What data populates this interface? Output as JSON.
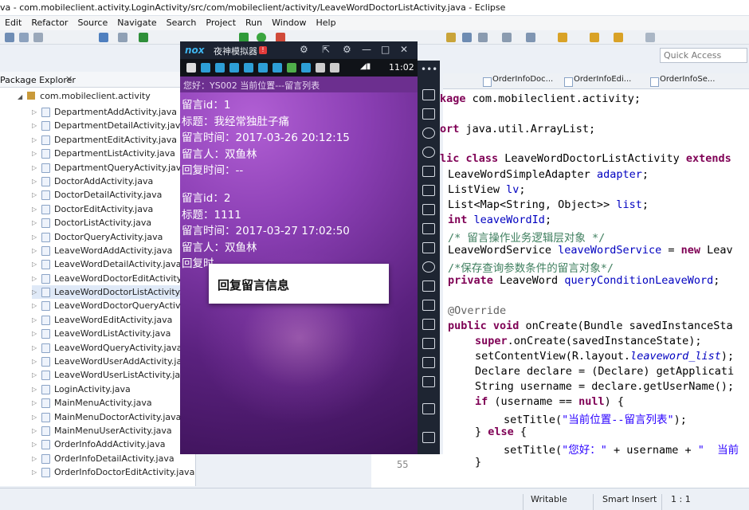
{
  "window": {
    "title": "va - com.mobileclient.activity.LoginActivity/src/com/mobileclient/activity/LeaveWordDoctorListActivity.java - Eclipse"
  },
  "menu": [
    "Edit",
    "Refactor",
    "Source",
    "Navigate",
    "Search",
    "Project",
    "Run",
    "Window",
    "Help"
  ],
  "quick_access": {
    "placeholder": "Quick Access"
  },
  "package_explorer": {
    "tab_label": "Package Explorer",
    "tab_close": "✕",
    "root": "com.mobileclient.activity",
    "files": [
      "DepartmentAddActivity.java",
      "DepartmentDetailActivity.java",
      "DepartmentEditActivity.java",
      "DepartmentListActivity.java",
      "DepartmentQueryActivity.java",
      "DoctorAddActivity.java",
      "DoctorDetailActivity.java",
      "DoctorEditActivity.java",
      "DoctorListActivity.java",
      "DoctorQueryActivity.java",
      "LeaveWordAddActivity.java",
      "LeaveWordDetailActivity.java",
      "LeaveWordDoctorEditActivity.java",
      "LeaveWordDoctorListActivity.java",
      "LeaveWordDoctorQueryActivity",
      "LeaveWordEditActivity.java",
      "LeaveWordListActivity.java",
      "LeaveWordQueryActivity.java",
      "LeaveWordUserAddActivity.java",
      "LeaveWordUserListActivity.java",
      "LoginActivity.java",
      "MainMenuActivity.java",
      "MainMenuDoctorActivity.java",
      "MainMenuUserActivity.java",
      "OrderInfoAddActivity.java",
      "OrderInfoDetailActivity.java",
      "OrderInfoDoctorEditActivity.java"
    ],
    "selected_index": 13
  },
  "editor": {
    "tabs": [
      "OrderInfoDoc...",
      "OrderInfoEdi...",
      "OrderInfoSe..."
    ],
    "gutter_line": "55",
    "code": {
      "l1a": "kage",
      "l1b": " com.mobileclient.activity;",
      "l2a": "ort",
      "l2b": " java.util.ArrayList;",
      "l3a": "lic class",
      "l3b": " LeaveWordDoctorListActivity ",
      "l3c": "extends",
      "l4a": "LeaveWordSimpleAdapter ",
      "l4b": "adapter",
      "l4c": ";",
      "l5a": "ListView ",
      "l5b": "lv",
      "l5c": ";",
      "l6a": "List<Map<String, Object>> ",
      "l6b": "list",
      "l6c": ";",
      "l7a": "int",
      "l7b": " leaveWordId",
      "l7c": ";",
      "l8": "/* 留言操作业务逻辑层对象 */",
      "l9a": "LeaveWordService ",
      "l9b": "leaveWordService",
      "l9c": " = ",
      "l9d": "new",
      "l9e": " Leav",
      "l10": "/*保存查询参数条件的留言对象*/",
      "l11a": "private",
      "l11b": " LeaveWord ",
      "l11c": "queryConditionLeaveWord",
      "l11d": ";",
      "l12": "@Override",
      "l13a": "public void",
      "l13b": " onCreate(Bundle savedInstanceSta",
      "l14a": "super",
      "l14b": ".onCreate(savedInstanceState);",
      "l15a": "setContentView(R.layout.",
      "l15b": "leaveword_list",
      "l15c": ");",
      "l16": "Declare declare = (Declare) getApplicati",
      "l17": "String username = declare.getUserName();",
      "l18a": "if",
      "l18b": " (username == ",
      "l18c": "null",
      "l18d": ") {",
      "l19a": "setTitle(",
      "l19b": "\"当前位置--留言列表\"",
      "l19c": ");",
      "l20a": "} ",
      "l20b": "else",
      "l20c": " {",
      "l21a": "setTitle(",
      "l21b": "\"您好：\"",
      "l21c": " + username + ",
      "l21d": "\"  当前",
      "l22": "}"
    }
  },
  "statusbar": {
    "writable": "Writable",
    "insert": "Smart Insert",
    "position": "1 : 1"
  },
  "emulator": {
    "logo": "nox",
    "title": "夜神模拟器",
    "badge": "!",
    "controls": [
      "⚙",
      "⇱",
      "⚙",
      "—",
      "□",
      "✕"
    ],
    "status_time": "11:02",
    "app_title": "您好：YS002  当前位置---留言列表",
    "messages": [
      {
        "id_label": "留言id：",
        "id": "1",
        "title_label": "标题：",
        "title": "我经常独肚子痛",
        "time_label": "留言时间：",
        "time": "2017-03-26 20:12:15",
        "person_label": "留言人：",
        "person": "双鱼林",
        "reply_label": "回复时间：",
        "reply": "--"
      },
      {
        "id_label": "留言id：",
        "id": "2",
        "title_label": "标题：",
        "title": "1111",
        "time_label": "留言时间：",
        "time": "2017-03-27 17:02:50",
        "person_label": "留言人：",
        "person": "双鱼林",
        "reply_label": "回复时",
        "reply": ""
      }
    ],
    "dialog_item": "回复留言信息"
  },
  "colors": {
    "keyword": "#7f0055",
    "field": "#0000c0",
    "comment": "#3f7f5f",
    "string": "#2a00ff",
    "emulator_bg": "#8b3fb4"
  }
}
